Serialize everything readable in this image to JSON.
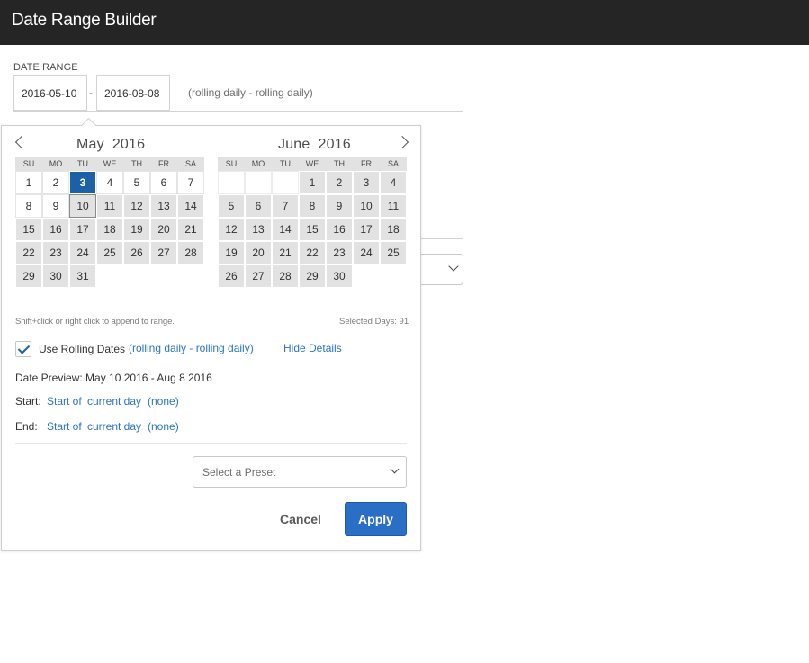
{
  "app": {
    "title": "Date Range Builder"
  },
  "range": {
    "label": "DATE RANGE",
    "start": "2016-05-10",
    "separator": "-",
    "end": "2016-08-08",
    "rolling_hint": "(rolling daily - rolling daily)"
  },
  "calendar": {
    "weekdays": [
      "SU",
      "MO",
      "TU",
      "WE",
      "TH",
      "FR",
      "SA"
    ],
    "months": [
      {
        "name": "May",
        "year": "2016",
        "first_weekday": 0,
        "days": 31,
        "range_from": 10,
        "today": 3,
        "range_start": 10
      },
      {
        "name": "June",
        "year": "2016",
        "first_weekday": 3,
        "days": 30,
        "range_from": 1,
        "today": null,
        "range_start": null
      }
    ]
  },
  "info": {
    "hint": "Shift+click or right click to append to range.",
    "selected_days": "Selected Days: 91"
  },
  "rolling": {
    "checked": true,
    "label": "Use Rolling Dates",
    "link": "(rolling daily - rolling daily)",
    "hide_details": "Hide Details"
  },
  "details": {
    "preview": "Date Preview: May 10 2016 - Aug 8 2016",
    "start_label": "Start:",
    "start_of": "Start of",
    "start_unit": "current day",
    "start_offset": "(none)",
    "end_label": "End:",
    "end_of": "Start of",
    "end_unit": "current day",
    "end_offset": "(none)"
  },
  "preset": {
    "placeholder": "Select a Preset"
  },
  "actions": {
    "cancel": "Cancel",
    "apply": "Apply"
  },
  "colors": {
    "accent": "#2a6ec5",
    "selected_day": "#1c60a7",
    "link": "#2b74c2",
    "titlebar": "#252525"
  }
}
